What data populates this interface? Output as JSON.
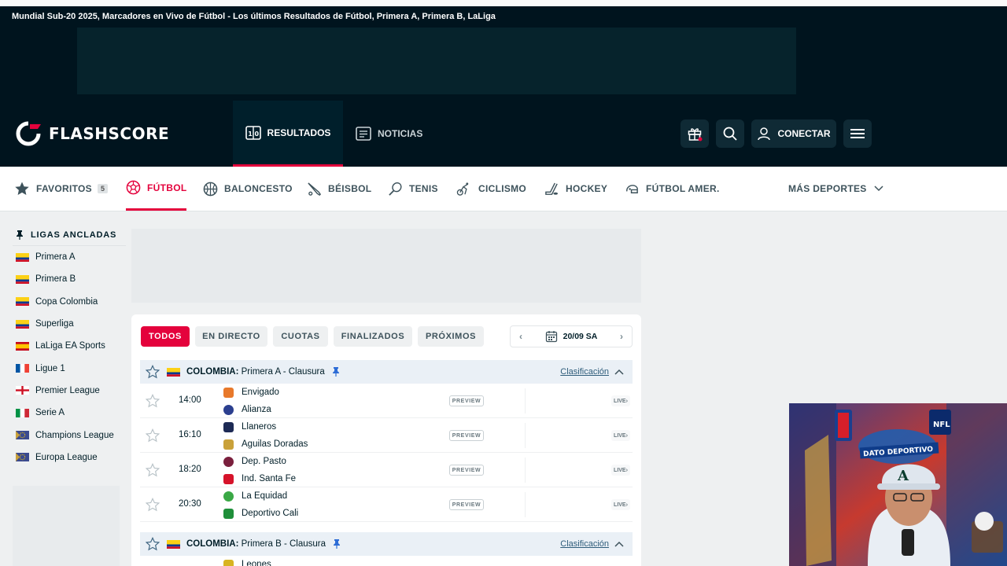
{
  "window": {
    "title": "Mundial Sub-20 2025, Marcadores en Vivo de Fútbol - Los últimos Resultados de Fútbol, Primera A, Primera B, LaLiga"
  },
  "header": {
    "logo_text": "FLASHSCORE",
    "tabs": [
      {
        "label": "RESULTADOS",
        "icon": "scoreboard-icon",
        "active": true
      },
      {
        "label": "NOTICIAS",
        "icon": "news-icon",
        "active": false
      }
    ],
    "login_label": "CONECTAR"
  },
  "sports": [
    {
      "label": "FAVORITOS",
      "icon": "star-icon",
      "count": "5"
    },
    {
      "label": "FÚTBOL",
      "icon": "soccer-ball-icon",
      "active": true
    },
    {
      "label": "BALONCESTO",
      "icon": "basketball-icon"
    },
    {
      "label": "BÉISBOL",
      "icon": "baseball-bat-icon"
    },
    {
      "label": "TENIS",
      "icon": "tennis-racket-icon"
    },
    {
      "label": "CICLISMO",
      "icon": "cycling-icon"
    },
    {
      "label": "HOCKEY",
      "icon": "hockey-stick-icon"
    },
    {
      "label": "FÚTBOL AMER.",
      "icon": "football-helmet-icon"
    },
    {
      "label": "MÁS DEPORTES",
      "icon": "chevron-down-icon"
    }
  ],
  "sidebar": {
    "title": "LIGAS ANCLADAS",
    "leagues": [
      {
        "name": "Primera A",
        "flag": "colombia"
      },
      {
        "name": "Primera B",
        "flag": "colombia"
      },
      {
        "name": "Copa Colombia",
        "flag": "colombia"
      },
      {
        "name": "Superliga",
        "flag": "colombia"
      },
      {
        "name": "LaLiga EA Sports",
        "flag": "spain"
      },
      {
        "name": "Ligue 1",
        "flag": "france"
      },
      {
        "name": "Premier League",
        "flag": "england"
      },
      {
        "name": "Serie A",
        "flag": "italy"
      },
      {
        "name": "Champions League",
        "flag": "europe"
      },
      {
        "name": "Europa League",
        "flag": "europe"
      }
    ]
  },
  "filters": [
    {
      "label": "TODOS",
      "active": true
    },
    {
      "label": "EN DIRECTO"
    },
    {
      "label": "CUOTAS"
    },
    {
      "label": "FINALIZADOS"
    },
    {
      "label": "PRÓXIMOS"
    }
  ],
  "date": {
    "label": "20/09 SA"
  },
  "competitions": [
    {
      "country": "COLOMBIA:",
      "league": "Primera A - Clausura",
      "standings_label": "Clasificación",
      "matches": [
        {
          "time": "14:00",
          "home": "Envigado",
          "away": "Alianza",
          "home_color": "#e8792b",
          "away_color": "#2b3f8f",
          "preview": "PREVIEW",
          "live": "LIVE"
        },
        {
          "time": "16:10",
          "home": "Llaneros",
          "away": "Aguilas Doradas",
          "home_color": "#1d2a55",
          "away_color": "#c9a13a",
          "preview": "PREVIEW",
          "live": "LIVE"
        },
        {
          "time": "18:20",
          "home": "Dep. Pasto",
          "away": "Ind. Santa Fe",
          "home_color": "#7a1f3d",
          "away_color": "#d6132a",
          "preview": "PREVIEW",
          "live": "LIVE"
        },
        {
          "time": "20:30",
          "home": "La Equidad",
          "away": "Deportivo Cali",
          "home_color": "#3aa845",
          "away_color": "#1f8f3a",
          "preview": "PREVIEW",
          "live": "LIVE"
        }
      ]
    },
    {
      "country": "COLOMBIA:",
      "league": "Primera B - Clausura",
      "standings_label": "Clasificación",
      "matches": [
        {
          "time": "",
          "home": "Leones",
          "away": "",
          "home_color": "#d8b422",
          "away_color": "#ffffff",
          "preview": "",
          "live": ""
        }
      ]
    }
  ],
  "colors": {
    "accent": "#e4023c",
    "header_bg": "#00141e",
    "league_header_bg": "#eaf0f6"
  }
}
